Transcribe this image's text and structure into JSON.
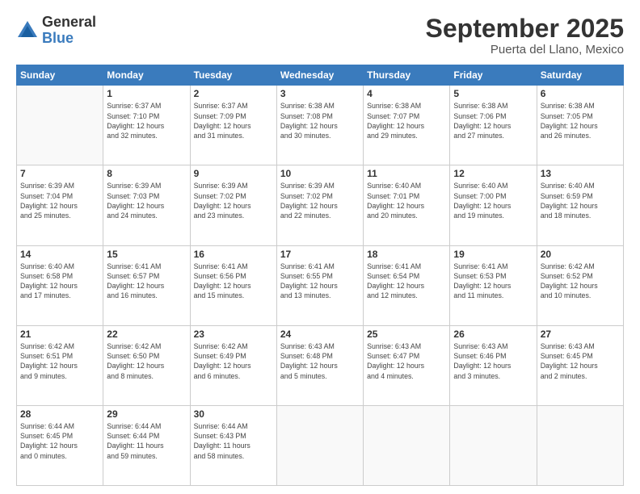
{
  "header": {
    "logo_general": "General",
    "logo_blue": "Blue",
    "month": "September 2025",
    "location": "Puerta del Llano, Mexico"
  },
  "weekdays": [
    "Sunday",
    "Monday",
    "Tuesday",
    "Wednesday",
    "Thursday",
    "Friday",
    "Saturday"
  ],
  "weeks": [
    [
      {
        "day": "",
        "info": ""
      },
      {
        "day": "1",
        "info": "Sunrise: 6:37 AM\nSunset: 7:10 PM\nDaylight: 12 hours\nand 32 minutes."
      },
      {
        "day": "2",
        "info": "Sunrise: 6:37 AM\nSunset: 7:09 PM\nDaylight: 12 hours\nand 31 minutes."
      },
      {
        "day": "3",
        "info": "Sunrise: 6:38 AM\nSunset: 7:08 PM\nDaylight: 12 hours\nand 30 minutes."
      },
      {
        "day": "4",
        "info": "Sunrise: 6:38 AM\nSunset: 7:07 PM\nDaylight: 12 hours\nand 29 minutes."
      },
      {
        "day": "5",
        "info": "Sunrise: 6:38 AM\nSunset: 7:06 PM\nDaylight: 12 hours\nand 27 minutes."
      },
      {
        "day": "6",
        "info": "Sunrise: 6:38 AM\nSunset: 7:05 PM\nDaylight: 12 hours\nand 26 minutes."
      }
    ],
    [
      {
        "day": "7",
        "info": "Sunrise: 6:39 AM\nSunset: 7:04 PM\nDaylight: 12 hours\nand 25 minutes."
      },
      {
        "day": "8",
        "info": "Sunrise: 6:39 AM\nSunset: 7:03 PM\nDaylight: 12 hours\nand 24 minutes."
      },
      {
        "day": "9",
        "info": "Sunrise: 6:39 AM\nSunset: 7:02 PM\nDaylight: 12 hours\nand 23 minutes."
      },
      {
        "day": "10",
        "info": "Sunrise: 6:39 AM\nSunset: 7:02 PM\nDaylight: 12 hours\nand 22 minutes."
      },
      {
        "day": "11",
        "info": "Sunrise: 6:40 AM\nSunset: 7:01 PM\nDaylight: 12 hours\nand 20 minutes."
      },
      {
        "day": "12",
        "info": "Sunrise: 6:40 AM\nSunset: 7:00 PM\nDaylight: 12 hours\nand 19 minutes."
      },
      {
        "day": "13",
        "info": "Sunrise: 6:40 AM\nSunset: 6:59 PM\nDaylight: 12 hours\nand 18 minutes."
      }
    ],
    [
      {
        "day": "14",
        "info": "Sunrise: 6:40 AM\nSunset: 6:58 PM\nDaylight: 12 hours\nand 17 minutes."
      },
      {
        "day": "15",
        "info": "Sunrise: 6:41 AM\nSunset: 6:57 PM\nDaylight: 12 hours\nand 16 minutes."
      },
      {
        "day": "16",
        "info": "Sunrise: 6:41 AM\nSunset: 6:56 PM\nDaylight: 12 hours\nand 15 minutes."
      },
      {
        "day": "17",
        "info": "Sunrise: 6:41 AM\nSunset: 6:55 PM\nDaylight: 12 hours\nand 13 minutes."
      },
      {
        "day": "18",
        "info": "Sunrise: 6:41 AM\nSunset: 6:54 PM\nDaylight: 12 hours\nand 12 minutes."
      },
      {
        "day": "19",
        "info": "Sunrise: 6:41 AM\nSunset: 6:53 PM\nDaylight: 12 hours\nand 11 minutes."
      },
      {
        "day": "20",
        "info": "Sunrise: 6:42 AM\nSunset: 6:52 PM\nDaylight: 12 hours\nand 10 minutes."
      }
    ],
    [
      {
        "day": "21",
        "info": "Sunrise: 6:42 AM\nSunset: 6:51 PM\nDaylight: 12 hours\nand 9 minutes."
      },
      {
        "day": "22",
        "info": "Sunrise: 6:42 AM\nSunset: 6:50 PM\nDaylight: 12 hours\nand 8 minutes."
      },
      {
        "day": "23",
        "info": "Sunrise: 6:42 AM\nSunset: 6:49 PM\nDaylight: 12 hours\nand 6 minutes."
      },
      {
        "day": "24",
        "info": "Sunrise: 6:43 AM\nSunset: 6:48 PM\nDaylight: 12 hours\nand 5 minutes."
      },
      {
        "day": "25",
        "info": "Sunrise: 6:43 AM\nSunset: 6:47 PM\nDaylight: 12 hours\nand 4 minutes."
      },
      {
        "day": "26",
        "info": "Sunrise: 6:43 AM\nSunset: 6:46 PM\nDaylight: 12 hours\nand 3 minutes."
      },
      {
        "day": "27",
        "info": "Sunrise: 6:43 AM\nSunset: 6:45 PM\nDaylight: 12 hours\nand 2 minutes."
      }
    ],
    [
      {
        "day": "28",
        "info": "Sunrise: 6:44 AM\nSunset: 6:45 PM\nDaylight: 12 hours\nand 0 minutes."
      },
      {
        "day": "29",
        "info": "Sunrise: 6:44 AM\nSunset: 6:44 PM\nDaylight: 11 hours\nand 59 minutes."
      },
      {
        "day": "30",
        "info": "Sunrise: 6:44 AM\nSunset: 6:43 PM\nDaylight: 11 hours\nand 58 minutes."
      },
      {
        "day": "",
        "info": ""
      },
      {
        "day": "",
        "info": ""
      },
      {
        "day": "",
        "info": ""
      },
      {
        "day": "",
        "info": ""
      }
    ]
  ]
}
